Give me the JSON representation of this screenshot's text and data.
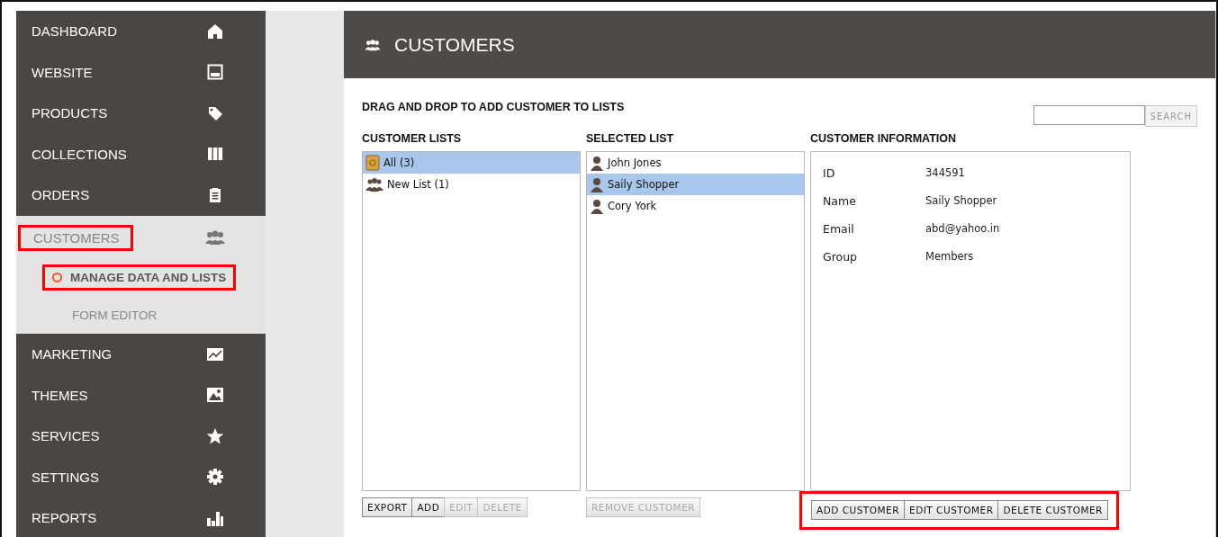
{
  "sidebar": {
    "items": [
      {
        "label": "DASHBOARD",
        "kind": "home",
        "expanded": false,
        "highlighted": false
      },
      {
        "label": "WEBSITE",
        "kind": "window",
        "expanded": false,
        "highlighted": false
      },
      {
        "label": "PRODUCTS",
        "kind": "tag",
        "expanded": false,
        "highlighted": false
      },
      {
        "label": "COLLECTIONS",
        "kind": "grid",
        "expanded": false,
        "highlighted": false
      },
      {
        "label": "ORDERS",
        "kind": "clipboard",
        "expanded": false,
        "highlighted": false
      },
      {
        "label": "CUSTOMERS",
        "kind": "people",
        "expanded": true,
        "highlighted": true,
        "children": [
          {
            "label": "MANAGE DATA AND LISTS",
            "selected": true,
            "highlighted": true
          },
          {
            "label": "FORM EDITOR",
            "selected": false,
            "highlighted": false
          }
        ]
      },
      {
        "label": "MARKETING",
        "kind": "chart",
        "expanded": false,
        "highlighted": false
      },
      {
        "label": "THEMES",
        "kind": "image",
        "expanded": false,
        "highlighted": false
      },
      {
        "label": "SERVICES",
        "kind": "star",
        "expanded": false,
        "highlighted": false
      },
      {
        "label": "SETTINGS",
        "kind": "gear",
        "expanded": false,
        "highlighted": false
      },
      {
        "label": "REPORTS",
        "kind": "bars",
        "expanded": false,
        "highlighted": false
      }
    ]
  },
  "header": {
    "title": "CUSTOMERS"
  },
  "instruction": "DRAG AND DROP TO ADD CUSTOMER TO LISTS",
  "search": {
    "button": "SEARCH"
  },
  "customer_lists": {
    "title": "CUSTOMER LISTS",
    "items": [
      {
        "label": "All (3)",
        "kind": "book",
        "selected": true
      },
      {
        "label": "New List (1)",
        "kind": "group",
        "selected": false
      }
    ],
    "buttons": [
      {
        "label": "EXPORT",
        "disabled": false
      },
      {
        "label": "ADD",
        "disabled": false
      },
      {
        "label": "EDIT",
        "disabled": true
      },
      {
        "label": "DELETE",
        "disabled": true
      }
    ]
  },
  "selected_list": {
    "title": "SELECTED LIST",
    "items": [
      {
        "label": "John Jones",
        "kind": "person",
        "selected": false
      },
      {
        "label": "Saily Shopper",
        "kind": "person",
        "selected": true
      },
      {
        "label": "Cory York",
        "kind": "person",
        "selected": false
      }
    ],
    "buttons": [
      {
        "label": "REMOVE CUSTOMER",
        "disabled": true
      }
    ]
  },
  "customer_information": {
    "title": "CUSTOMER INFORMATION",
    "fields": [
      {
        "label": "ID",
        "value": "344591"
      },
      {
        "label": "Name",
        "value": "Saily Shopper"
      },
      {
        "label": "Email",
        "value": "abd@yahoo.in"
      },
      {
        "label": "Group",
        "value": "Members"
      }
    ],
    "highlighted": true,
    "buttons": [
      {
        "label": "ADD CUSTOMER",
        "disabled": false
      },
      {
        "label": "EDIT CUSTOMER",
        "disabled": false
      },
      {
        "label": "DELETE CUSTOMER",
        "disabled": false
      }
    ]
  }
}
